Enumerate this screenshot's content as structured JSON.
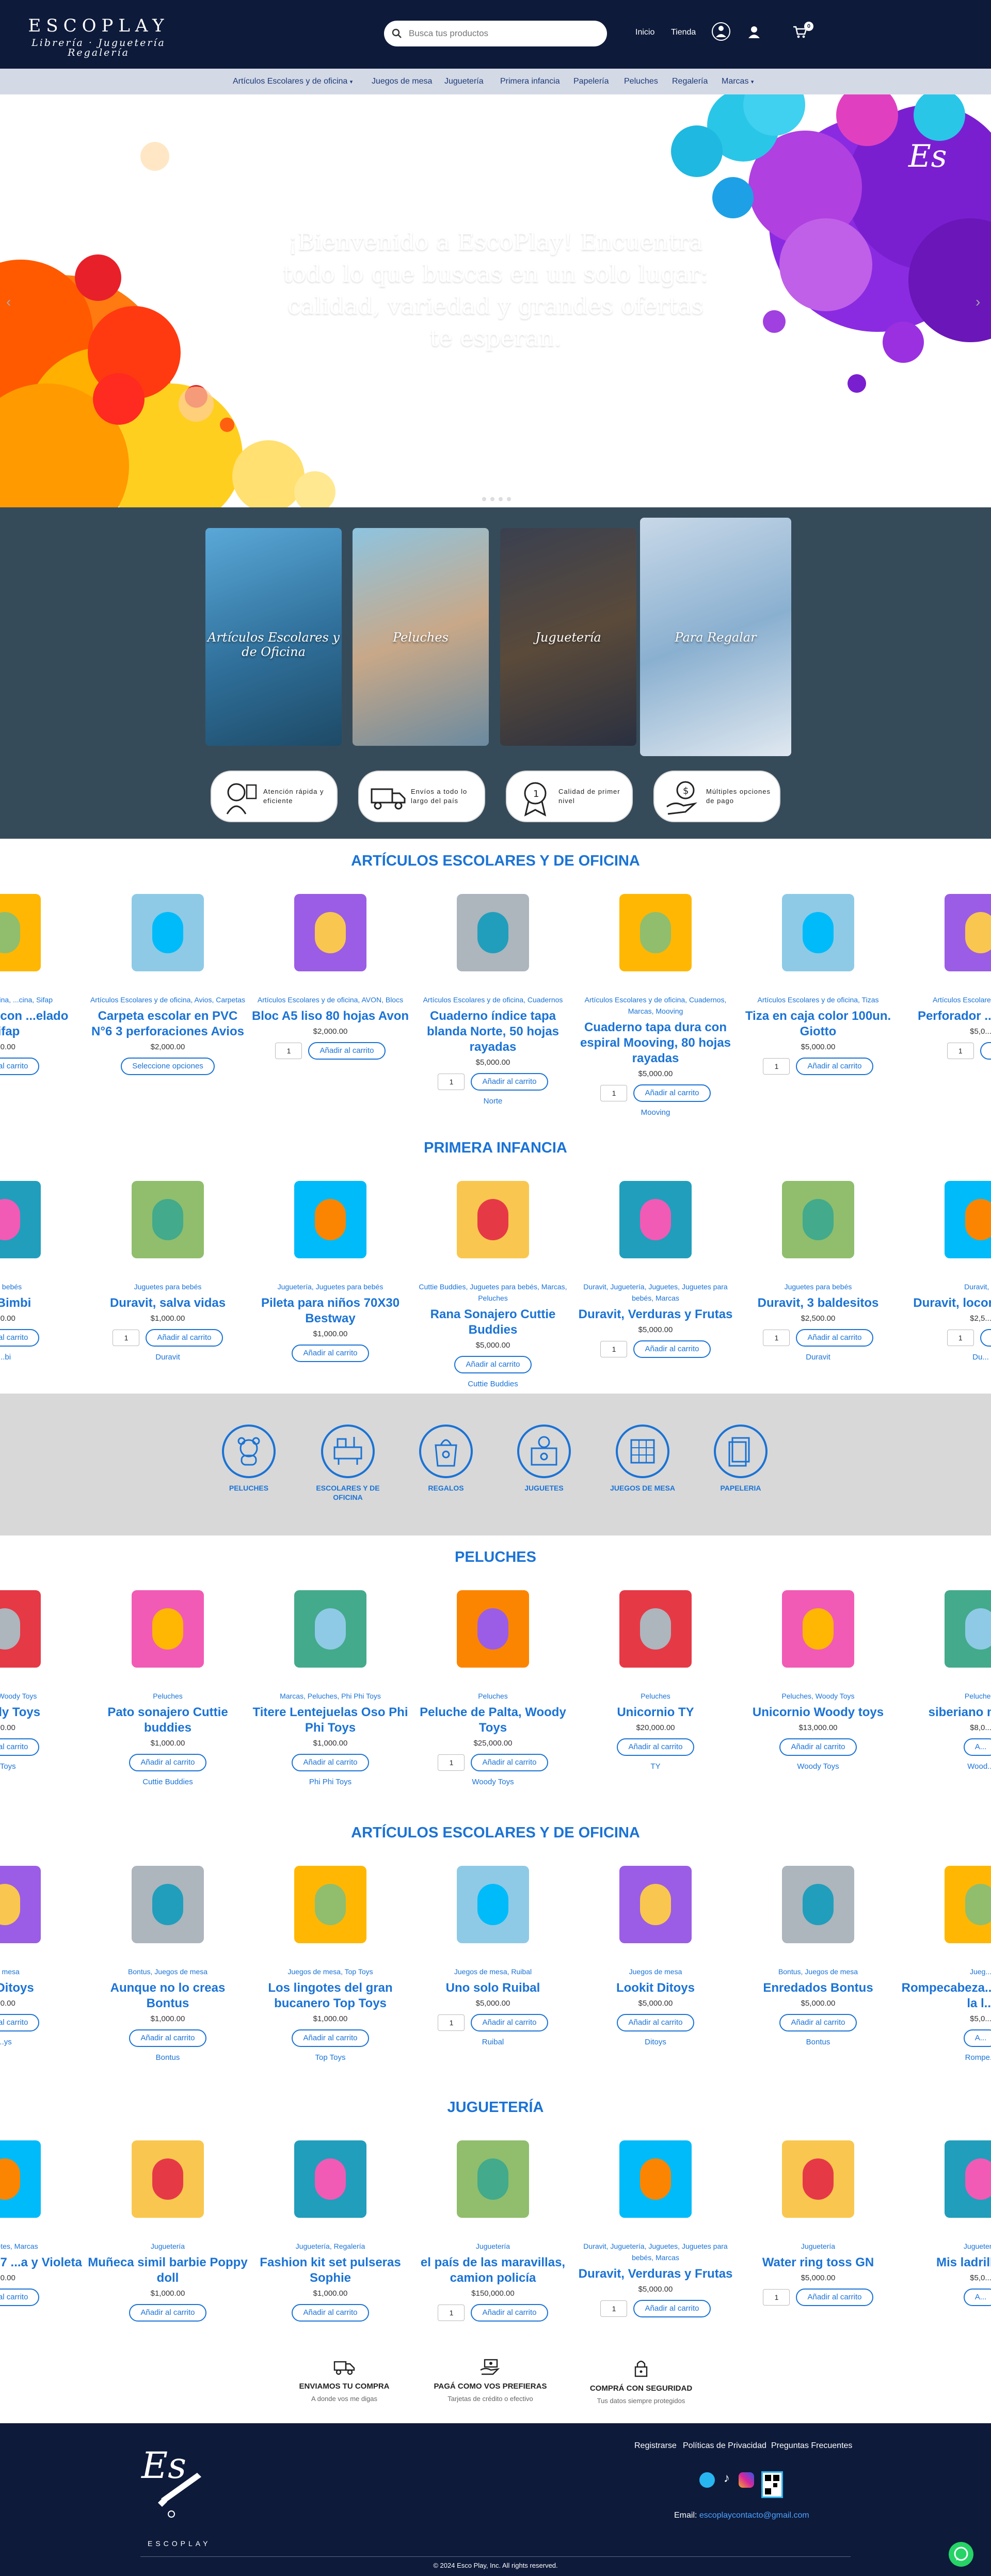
{
  "header": {
    "logo_title": "ESCOPLAY",
    "logo_subtitle_1": "Librería · Juguetería",
    "logo_subtitle_2": "Regalería",
    "search_placeholder": "Busca tus productos",
    "nav_home": "Inicio",
    "nav_store": "Tienda",
    "cart_count": "0"
  },
  "menu": {
    "items": [
      "Artículos Escolares y de oficina",
      "Juegos de mesa",
      "Juguetería",
      "Primera infancia",
      "Papelería",
      "Peluches",
      "Regalería",
      "Marcas"
    ]
  },
  "hero": {
    "text": "¡Bienvenido a EscoPlay! Encuentra todo lo que buscas en un solo lugar: calidad, variedad y grandes ofertas te esperan.",
    "slides": 5
  },
  "categories": [
    {
      "label": "Artículos Escolares y de Oficina"
    },
    {
      "label": "Peluches"
    },
    {
      "label": "Juguetería"
    },
    {
      "label": "Para Regalar"
    }
  ],
  "features": [
    {
      "line1": "Atención rápida y",
      "line2": "eficiente"
    },
    {
      "line1": "Envíos a todo lo",
      "line2": "largo del país"
    },
    {
      "line1": "Calidad de primer",
      "line2": "nivel"
    },
    {
      "line1": "Múltiples opciones",
      "line2": "de pago"
    }
  ],
  "sections": {
    "s1": {
      "title": "ARTÍCULOS ESCOLARES Y DE OFICINA",
      "products": [
        {
          "cat": "...es y de oficina, ...cina, Sifap",
          "name": "...el 12cm con ...elado Sifap",
          "price": "...0.00",
          "qty": "",
          "btn": "...dir al carrito",
          "brand": ""
        },
        {
          "cat": "Artículos Escolares y de oficina, Avios, Carpetas",
          "name": "Carpeta escolar en PVC N°6 3 perforaciones Avios",
          "price": "$2,000.00",
          "qty": "",
          "btn": "Seleccione opciones",
          "brand": ""
        },
        {
          "cat": "Artículos Escolares y de oficina, AVON, Blocs",
          "name": "Bloc A5 liso 80 hojas Avon",
          "price": "$2,000.00",
          "qty": "1",
          "btn": "Añadir al carrito",
          "brand": ""
        },
        {
          "cat": "Artículos Escolares y de oficina, Cuadernos",
          "name": "Cuaderno índice tapa blanda Norte, 50 hojas rayadas",
          "price": "$5,000.00",
          "qty": "1",
          "btn": "Añadir al carrito",
          "brand": "Norte"
        },
        {
          "cat": "Artículos Escolares y de oficina, Cuadernos, Marcas, Mooving",
          "name": "Cuaderno tapa dura con espiral Mooving, 80 hojas rayadas",
          "price": "$5,000.00",
          "qty": "1",
          "btn": "Añadir al carrito",
          "brand": "Mooving"
        },
        {
          "cat": "Artículos Escolares y de oficina, Tizas",
          "name": "Tiza en caja color 100un. Giotto",
          "price": "$5,000.00",
          "qty": "1",
          "btn": "Añadir al carrito",
          "brand": ""
        },
        {
          "cat": "Artículos Escolares ...Marca...",
          "name": "Perforador ...Mapec...",
          "price": "$5,0...",
          "qty": "1",
          "btn": "A...",
          "brand": ""
        }
      ]
    },
    "s2": {
      "title": "PRIMERA INFANCIA",
      "products": [
        {
          "cat": "...ra bebés",
          "name": "...r Bimbi",
          "price": "...0.00",
          "qty": "",
          "btn": "...dir al carrito",
          "brand": "...bi"
        },
        {
          "cat": "Juguetes para bebés",
          "name": "Duravit, salva vidas",
          "price": "$1,000.00",
          "qty": "1",
          "btn": "Añadir al carrito",
          "brand": "Duravit"
        },
        {
          "cat": "Juguetería, Juguetes para bebés",
          "name": "Pileta para niños 70X30 Bestway",
          "price": "$1,000.00",
          "qty": "",
          "btn": "Añadir al carrito",
          "brand": ""
        },
        {
          "cat": "Cuttie Buddies, Juguetes para bebés, Marcas, Peluches",
          "name": "Rana Sonajero Cuttie Buddies",
          "price": "$5,000.00",
          "qty": "",
          "btn": "Añadir al carrito",
          "brand": "Cuttie Buddies"
        },
        {
          "cat": "Duravit, Juguetería, Juguetes, Juguetes para bebés, Marcas",
          "name": "Duravit, Verduras y Frutas",
          "price": "$5,000.00",
          "qty": "1",
          "btn": "Añadir al carrito",
          "brand": ""
        },
        {
          "cat": "Juguetes para bebés",
          "name": "Duravit, 3 baldesitos",
          "price": "$2,500.00",
          "qty": "1",
          "btn": "Añadir al carrito",
          "brand": "Duravit"
        },
        {
          "cat": "Duravit, ...",
          "name": "Duravit, locom... y so...",
          "price": "$2,5...",
          "qty": "1",
          "btn": "A...",
          "brand": "Du..."
        }
      ]
    },
    "s3": {
      "title": "PELUCHES",
      "products": [
        {
          "cat": "...ches, Woody Toys",
          "name": "...oody Toys",
          "price": "...0.00",
          "qty": "",
          "btn": "...dir al carrito",
          "brand": "...Toys"
        },
        {
          "cat": "Peluches",
          "name": "Pato sonajero Cuttie buddies",
          "price": "$1,000.00",
          "qty": "",
          "btn": "Añadir al carrito",
          "brand": "Cuttie Buddies"
        },
        {
          "cat": "Marcas, Peluches, Phi Phi Toys",
          "name": "Titere Lentejuelas Oso Phi Phi Toys",
          "price": "$1,000.00",
          "qty": "",
          "btn": "Añadir al carrito",
          "brand": "Phi Phi Toys"
        },
        {
          "cat": "Peluches",
          "name": "Peluche de Palta, Woody Toys",
          "price": "$25,000.00",
          "qty": "1",
          "btn": "Añadir al carrito",
          "brand": "Woody Toys"
        },
        {
          "cat": "Peluches",
          "name": "Unicornio TY",
          "price": "$20,000.00",
          "qty": "",
          "btn": "Añadir al carrito",
          "brand": "TY"
        },
        {
          "cat": "Peluches, Woody Toys",
          "name": "Unicornio Woody toys",
          "price": "$13,000.00",
          "qty": "",
          "btn": "Añadir al carrito",
          "brand": "Woody Toys"
        },
        {
          "cat": "Peluche...",
          "name": "siberiano m... tx...",
          "price": "$8,0...",
          "qty": "",
          "btn": "A...",
          "brand": "Wood..."
        }
      ]
    },
    "s4": {
      "title": "ARTÍCULOS ESCOLARES Y DE OFICINA",
      "products": [
        {
          "cat": "...e mesa",
          "name": "...ll Ditoys",
          "price": "...0.00",
          "qty": "",
          "btn": "...dir al carrito",
          "brand": "...ys"
        },
        {
          "cat": "Bontus, Juegos de mesa",
          "name": "Aunque no lo creas Bontus",
          "price": "$1,000.00",
          "qty": "",
          "btn": "Añadir al carrito",
          "brand": "Bontus"
        },
        {
          "cat": "Juegos de mesa, Top Toys",
          "name": "Los lingotes del gran bucanero Top Toys",
          "price": "$1,000.00",
          "qty": "",
          "btn": "Añadir al carrito",
          "brand": "Top Toys"
        },
        {
          "cat": "Juegos de mesa, Ruibal",
          "name": "Uno solo Ruibal",
          "price": "$5,000.00",
          "qty": "1",
          "btn": "Añadir al carrito",
          "brand": "Ruibal"
        },
        {
          "cat": "Juegos de mesa",
          "name": "Lookit Ditoys",
          "price": "$5,000.00",
          "qty": "",
          "btn": "Añadir al carrito",
          "brand": "Ditoys"
        },
        {
          "cat": "Bontus, Juegos de mesa",
          "name": "Enredados Bontus",
          "price": "$5,000.00",
          "qty": "",
          "btn": "Añadir al carrito",
          "brand": "Bontus"
        },
        {
          "cat": "Jueg...",
          "name": "Rompecabeza... estatua de la l...",
          "price": "$5,0...",
          "qty": "",
          "btn": "A...",
          "brand": "Rompe..."
        }
      ]
    },
    "s5": {
      "title": "JUGUETERÍA",
      "products": [
        {
          "cat": "...s juguetes, Marcas",
          "name": "...de Cocina 7 ...a y Violeta",
          "price": "...0.00",
          "qty": "",
          "btn": "...dir al carrito",
          "brand": ""
        },
        {
          "cat": "Juguetería",
          "name": "Muñeca simil barbie Poppy doll",
          "price": "$1,000.00",
          "qty": "",
          "btn": "Añadir al carrito",
          "brand": ""
        },
        {
          "cat": "Juguetería, Regalería",
          "name": "Fashion kit set pulseras Sophie",
          "price": "$1,000.00",
          "qty": "",
          "btn": "Añadir al carrito",
          "brand": ""
        },
        {
          "cat": "Juguetería",
          "name": "el país de las maravillas, camion policía",
          "price": "$150,000.00",
          "qty": "1",
          "btn": "Añadir al carrito",
          "brand": ""
        },
        {
          "cat": "Duravit, Juguetería, Juguetes, Juguetes para bebés, Marcas",
          "name": "Duravit, Verduras y Frutas",
          "price": "$5,000.00",
          "qty": "1",
          "btn": "Añadir al carrito",
          "brand": ""
        },
        {
          "cat": "Juguetería",
          "name": "Water ring toss GN",
          "price": "$5,000.00",
          "qty": "1",
          "btn": "Añadir al carrito",
          "brand": ""
        },
        {
          "cat": "Juguetería",
          "name": "Mis ladrillos, ...",
          "price": "$5,0...",
          "qty": "",
          "btn": "A...",
          "brand": ""
        }
      ]
    }
  },
  "icon_categories": [
    {
      "label": "PELUCHES"
    },
    {
      "label": "ESCOLARES Y DE OFICINA"
    },
    {
      "label": "REGALOS"
    },
    {
      "label": "JUGUETES"
    },
    {
      "label": "JUEGOS DE MESA"
    },
    {
      "label": "PAPELERIA"
    }
  ],
  "guarantees": [
    {
      "title": "ENVIAMOS TU COMPRA",
      "sub": "A donde vos me digas"
    },
    {
      "title": "PAGÁ COMO VOS PREFIERAS",
      "sub": "Tarjetas de crédito o efectivo"
    },
    {
      "title": "COMPRÁ CON SEGURIDAD",
      "sub": "Tus datos siempre protegidos"
    }
  ],
  "footer": {
    "logo_text": "ESCOPLAY",
    "links": [
      "Registrarse",
      "Políticas de Privacidad",
      "Preguntas Frecuentes"
    ],
    "email_label": "Email:",
    "email": "escoplaycontacto@gmail.com",
    "copyright": "© 2024 Esco Play, Inc. All rights reserved."
  },
  "colors": {
    "navy": "#0d1a3a",
    "accent": "#1a73d6",
    "menubar": "#d4d9e6",
    "band": "#364b5a"
  }
}
